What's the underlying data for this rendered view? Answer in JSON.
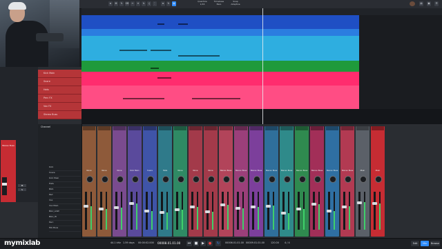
{
  "toolbar": {
    "quantize_label": "Quantize",
    "quantize_value": "1/16",
    "timebase_label": "Timebase",
    "timebase_value": "Bars",
    "snap_label": "Snap",
    "snap_value": "Adaptive"
  },
  "track_headers": [
    {
      "label": "Kick Main"
    },
    {
      "label": "Snare"
    },
    {
      "label": "Hats"
    },
    {
      "label": "Perc FX"
    },
    {
      "label": "Vox FX"
    },
    {
      "label": "Stereo Buss"
    }
  ],
  "browser": {
    "title": "Channel",
    "items": [
      "Kick",
      "Snare",
      "Kick Main",
      "Hats",
      "BGS",
      "Pad",
      "Vox",
      "Vox Main",
      "BGV_LOW",
      "BGV_HI",
      "Perc",
      "Mix Buss"
    ]
  },
  "channels": [
    {
      "name": "None",
      "color": "#8e5a3a",
      "level": 0.62
    },
    {
      "name": "None",
      "color": "#8e5a3a",
      "level": 0.55
    },
    {
      "name": "None",
      "color": "#7a4b8f",
      "level": 0.58
    },
    {
      "name": "Kick Main",
      "color": "#5a4a9c",
      "level": 0.7
    },
    {
      "name": "Snare",
      "color": "#3f54a8",
      "level": 0.5
    },
    {
      "name": "Hats",
      "color": "#2f7a8a",
      "level": 0.45
    },
    {
      "name": "None",
      "color": "#2f8a64",
      "level": 0.52
    },
    {
      "name": "None",
      "color": "#a33a4a",
      "level": 0.6
    },
    {
      "name": "None",
      "color": "#a33a4a",
      "level": 0.48
    },
    {
      "name": "Stereo Buss",
      "color": "#b2445a",
      "level": 0.66
    },
    {
      "name": "Stereo Buss",
      "color": "#9b3f7a",
      "level": 0.57
    },
    {
      "name": "Stereo Buss",
      "color": "#7c3f9b",
      "level": 0.6
    },
    {
      "name": "Stereo Buss",
      "color": "#2f6f9b",
      "level": 0.63
    },
    {
      "name": "Stereo Buss",
      "color": "#2f8a8a",
      "level": 0.44
    },
    {
      "name": "Stereo Buss",
      "color": "#2f8a4f",
      "level": 0.55
    },
    {
      "name": "Stereo Buss",
      "color": "#a22f58",
      "level": 0.68
    },
    {
      "name": "Stereo Buss",
      "color": "#2f6fa2",
      "level": 0.5
    },
    {
      "name": "Stereo Buss",
      "color": "#b23a52",
      "level": 0.61
    },
    {
      "name": "Main",
      "color": "#5b6068",
      "level": 0.72
    },
    {
      "name": "Main",
      "color": "#c62c33",
      "level": 0.7
    }
  ],
  "inspector": {
    "track_name": "Stereo Buss",
    "buttons": [
      "M",
      "S"
    ]
  },
  "transport": {
    "logo": "mymixlab",
    "sample_rate": "44.1 kHz",
    "buffer": "1.59 days",
    "position": "00008.01.01.00",
    "time": "00:00:02.000",
    "loop_start": "00006.01.01.00",
    "loop_end": "00009.01.01.00",
    "tempo": "120.00",
    "signature": "4 / 4",
    "buttons": [
      "Edit",
      "Mix",
      "Browse"
    ]
  },
  "colors": {
    "lane_blue_dark": "#1f4fc4",
    "lane_blue": "#2b7de0",
    "lane_cyan": "#2eaee0",
    "lane_green": "#1f9a3b",
    "lane_pink": "#ff2c6e",
    "lane_pink2": "#ff4d84",
    "track_red": "#b53538",
    "accent": "#2d8cff"
  }
}
